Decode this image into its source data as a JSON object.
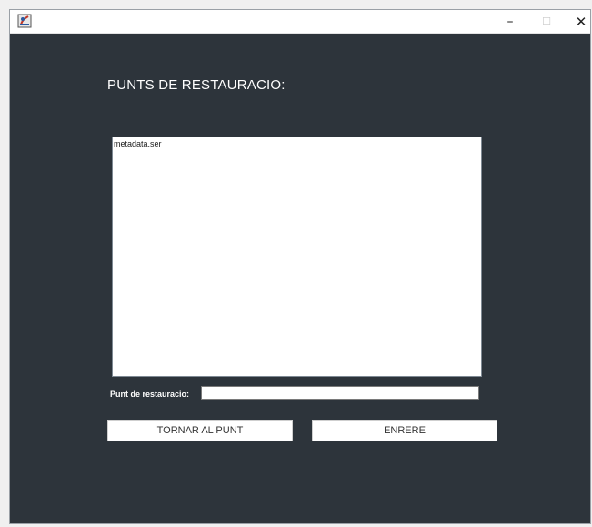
{
  "window": {
    "title": "",
    "icon": "java-app-icon",
    "controls": {
      "minimize": "–",
      "maximize": "☐",
      "close": "✕"
    }
  },
  "main": {
    "heading": "PUNTS DE RESTAURACIO:",
    "restore_points": [
      {
        "label": "metadata.ser"
      }
    ],
    "field_label": "Punt de restauracio:",
    "field_value": "",
    "buttons": {
      "return_label": "TORNAR AL PUNT",
      "exit_label": "ENRERE"
    }
  },
  "colors": {
    "background": "#2d343b",
    "heading_text": "#ffffff",
    "button_bg": "#ffffff"
  }
}
